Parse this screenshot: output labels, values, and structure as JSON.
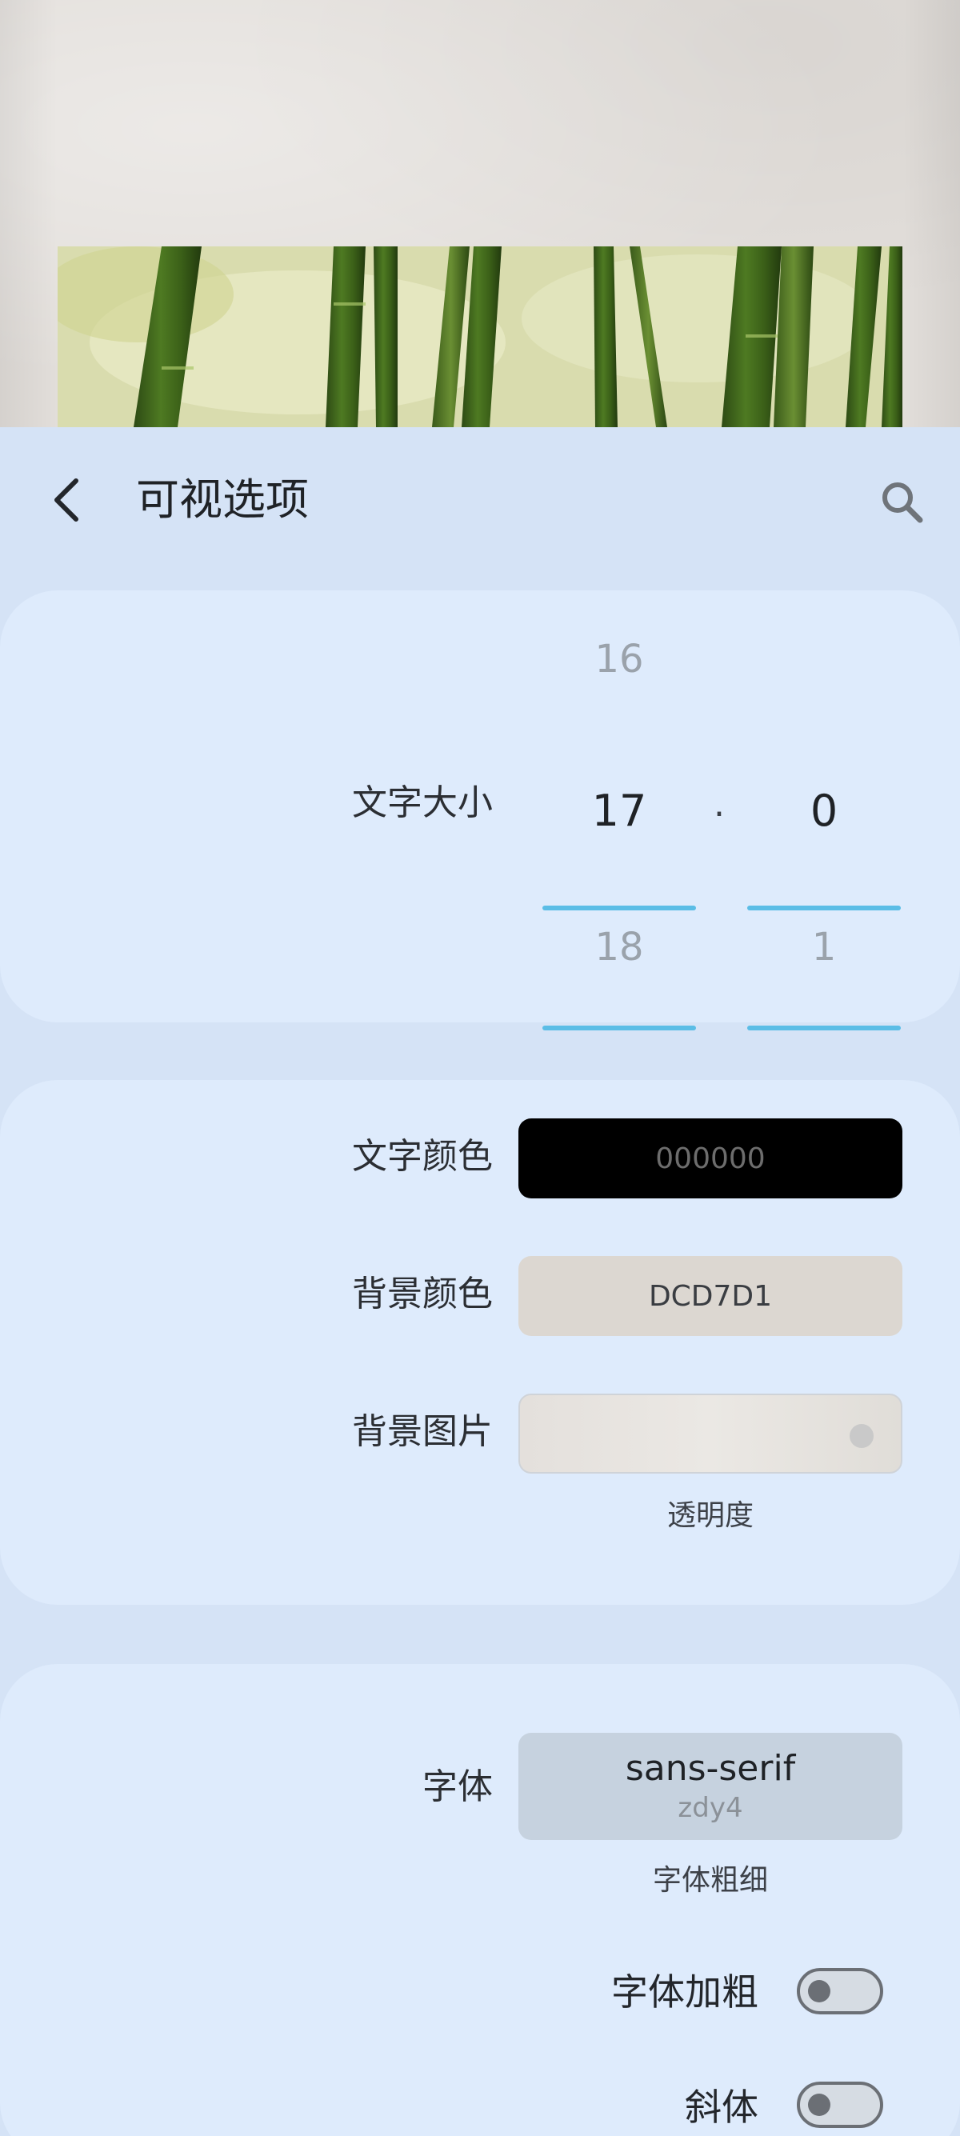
{
  "header": {
    "title": "可视选项",
    "back_icon": "chevron-left-icon",
    "search_icon": "search-icon"
  },
  "text_size": {
    "label": "文字大小",
    "integer": {
      "above": "16",
      "selected": "17",
      "below": "18"
    },
    "decimal_separator": ".",
    "fraction": {
      "above": "",
      "selected": "0",
      "below": "1"
    }
  },
  "colors": {
    "text_color": {
      "label": "文字颜色",
      "value": "000000",
      "swatch": "#000000"
    },
    "background_color": {
      "label": "背景颜色",
      "value": "DCD7D1",
      "swatch": "#DCD7D1"
    },
    "background_image": {
      "label": "背景图片",
      "opacity_label": "透明度"
    }
  },
  "font": {
    "label": "字体",
    "name": "sans-serif",
    "sub": "zdy4",
    "weight_label": "字体粗细",
    "bold": {
      "label": "字体加粗",
      "on": false
    },
    "italic": {
      "label": "斜体",
      "on": false
    }
  },
  "theme": {
    "accent": "#5BBDE6",
    "sheet_bg": "#D5E3F6",
    "card_bg": "#DEEBFC"
  }
}
